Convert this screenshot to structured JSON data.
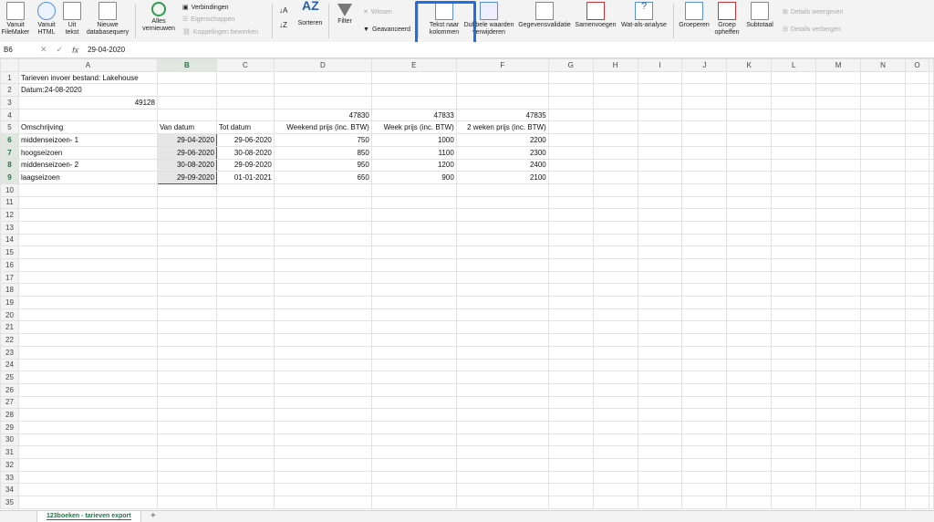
{
  "ribbon": {
    "vanuit_filemaker": "Vanuit\nFileMaker",
    "vanuit_html": "Vanuit\nHTML",
    "uit_tekst": "Uit\ntekst",
    "nieuwe_query": "Nieuwe\ndatabasequery",
    "alles_vernieuwen": "Alles\nvernieuwen",
    "verbindingen": "Verbindingen",
    "eigenschappen": "Eigenschappen",
    "koppelingen": "Koppelingen bewerken",
    "sorteren": "Sorteren",
    "filter": "Filter",
    "wissen": "Wissen",
    "geavanceerd": "Geavanceerd",
    "tekst_naar_kolommen": "Tekst naar\nkolommen",
    "dubbele_waarden": "Dubbele waarden\nverwijderen",
    "gegevensvalidatie": "Gegevensvalidatie",
    "samenvoegen": "Samenvoegen",
    "wat_als": "Wat-als-analyse",
    "groeperen": "Groeperen",
    "groep_opheffen": "Groep\nopheffen",
    "subtotaal": "Subtotaal",
    "details_weergeven": "Details weergeven",
    "details_verbergen": "Details verbergen"
  },
  "formula_bar": {
    "name_box": "B6",
    "cancel": "✕",
    "enter": "✓",
    "fx": "fx",
    "value": "29-04-2020"
  },
  "columns": [
    "A",
    "B",
    "C",
    "D",
    "E",
    "F",
    "G",
    "H",
    "I",
    "J",
    "K",
    "L",
    "M",
    "N",
    "O"
  ],
  "rows": [
    [
      "Tarieven invoer bestand: Lakehouse",
      "",
      "",
      "",
      "",
      "",
      "",
      "",
      "",
      "",
      "",
      "",
      "",
      "",
      ""
    ],
    [
      "Datum:24-08-2020",
      "",
      "",
      "",
      "",
      "",
      "",
      "",
      "",
      "",
      "",
      "",
      "",
      "",
      ""
    ],
    [
      "49128",
      "",
      "",
      "",
      "",
      "",
      "",
      "",
      "",
      "",
      "",
      "",
      "",
      "",
      ""
    ],
    [
      "",
      "",
      "",
      "47830",
      "47833",
      "47835",
      "",
      "",
      "",
      "",
      "",
      "",
      "",
      "",
      ""
    ],
    [
      "Omschrijving",
      "Van datum",
      "Tot datum",
      "Weekend prijs (inc. BTW)",
      "Week prijs (inc. BTW)",
      "2 weken prijs (inc. BTW)",
      "",
      "",
      "",
      "",
      "",
      "",
      "",
      "",
      ""
    ],
    [
      "middenseizoen- 1",
      "29-04-2020",
      "29-06-2020",
      "750",
      "1000",
      "2200",
      "",
      "",
      "",
      "",
      "",
      "",
      "",
      "",
      ""
    ],
    [
      "hoogseizoen",
      "29-06-2020",
      "30-08-2020",
      "850",
      "1100",
      "2300",
      "",
      "",
      "",
      "",
      "",
      "",
      "",
      "",
      ""
    ],
    [
      "middenseizoen- 2",
      "30-08-2020",
      "29-09-2020",
      "950",
      "1200",
      "2400",
      "",
      "",
      "",
      "",
      "",
      "",
      "",
      "",
      ""
    ],
    [
      "laagseizoen",
      "29-09-2020",
      "01-01-2021",
      "650",
      "900",
      "2100",
      "",
      "",
      "",
      "",
      "",
      "",
      "",
      "",
      ""
    ]
  ],
  "total_rows": 35,
  "sheet_tab": "123boeken - tarieven export",
  "add_sheet": "+",
  "accent_color": "#217346",
  "highlight_color": "#1f6fe0"
}
